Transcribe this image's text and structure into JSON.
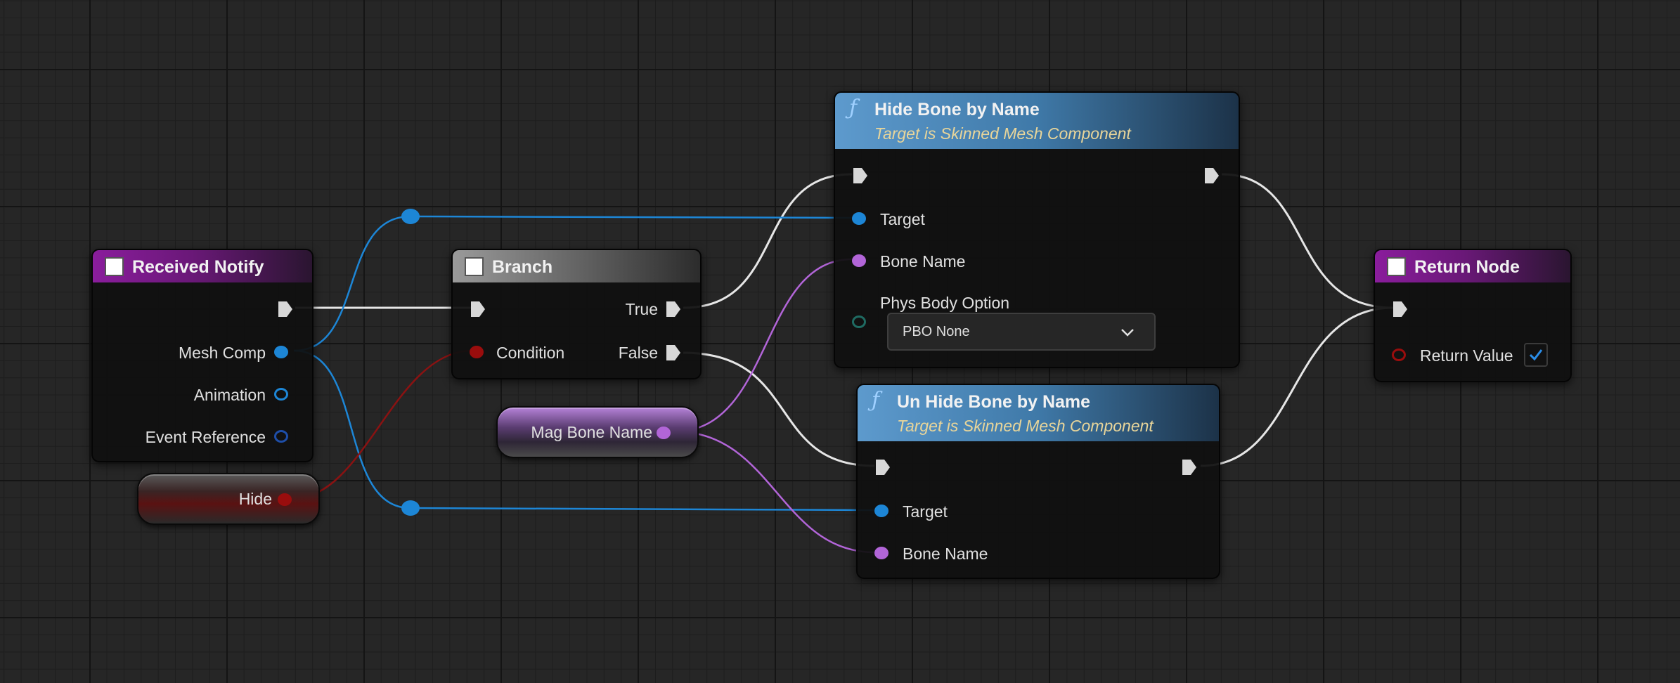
{
  "colors": {
    "exec": "#e6e6e6",
    "object": "#1d86d6",
    "name": "#b265d8",
    "bool": "#9a0d0d",
    "header_event": "#8a1d9c",
    "header_function": "#5d9acd"
  },
  "nodes": {
    "received_notify": {
      "title": "Received Notify",
      "pins": {
        "mesh_comp": "Mesh Comp",
        "animation": "Animation",
        "event_reference": "Event Reference"
      }
    },
    "hide_var": {
      "label": "Hide"
    },
    "branch": {
      "title": "Branch",
      "pins": {
        "condition": "Condition",
        "true": "True",
        "false": "False"
      }
    },
    "mag_bone_var": {
      "label": "Mag Bone Name"
    },
    "hide_bone": {
      "title": "Hide Bone by Name",
      "subtitle": "Target is Skinned Mesh Component",
      "pins": {
        "target": "Target",
        "bone_name": "Bone Name",
        "phys_body_option": "Phys Body Option"
      },
      "phys_body_value": "PBO None"
    },
    "unhide_bone": {
      "title": "Un Hide Bone by Name",
      "subtitle": "Target is Skinned Mesh Component",
      "pins": {
        "target": "Target",
        "bone_name": "Bone Name"
      }
    },
    "return_node": {
      "title": "Return Node",
      "pins": {
        "return_value": "Return Value"
      },
      "return_value_checked": true
    }
  }
}
